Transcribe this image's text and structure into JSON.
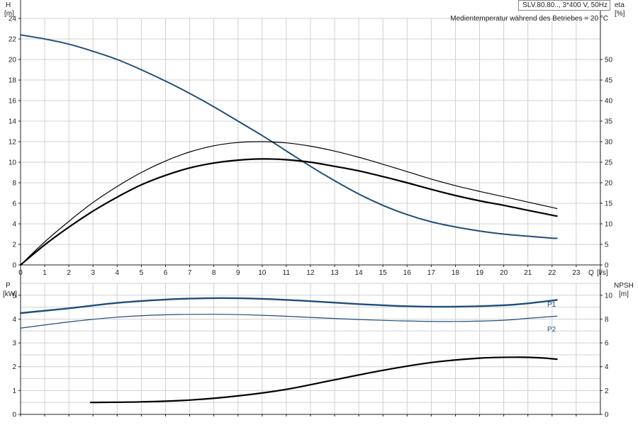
{
  "info": {
    "title": "SLV.80.80.., 3*400 V, 50Hz",
    "note": "Medientemperatur während des Betriebes = 20 °C"
  },
  "chart_data": [
    {
      "type": "line",
      "axes": {
        "x": {
          "label_name": "Q",
          "label_unit": "[l/s]",
          "range": [
            0,
            24
          ],
          "ticks": [
            0,
            1,
            2,
            3,
            4,
            5,
            6,
            7,
            8,
            9,
            10,
            11,
            12,
            13,
            14,
            15,
            16,
            17,
            18,
            19,
            20,
            21,
            22,
            23
          ]
        },
        "y_left": {
          "label_name": "H",
          "label_unit": "[m]",
          "range": [
            0,
            24
          ],
          "ticks": [
            0,
            2,
            4,
            6,
            8,
            10,
            12,
            14,
            16,
            18,
            20,
            22,
            24
          ]
        },
        "y_right": {
          "label_name": "eta",
          "label_unit": "[%]",
          "range": [
            0,
            60
          ],
          "ticks": [
            0,
            5,
            10,
            15,
            20,
            25,
            30,
            35,
            40,
            45,
            50
          ]
        }
      },
      "grid": true,
      "series": [
        {
          "axis": "left",
          "color": "#1f4e79",
          "width": 2,
          "points": [
            [
              0,
              22.4
            ],
            [
              1,
              22.0
            ],
            [
              2,
              21.5
            ],
            [
              3,
              20.8
            ],
            [
              4,
              20.0
            ],
            [
              5,
              19.0
            ],
            [
              6,
              17.9
            ],
            [
              7,
              16.7
            ],
            [
              8,
              15.4
            ],
            [
              9,
              14.0
            ],
            [
              10,
              12.6
            ],
            [
              11,
              11.1
            ],
            [
              12,
              9.6
            ],
            [
              13,
              8.2
            ],
            [
              14,
              6.9
            ],
            [
              15,
              5.8
            ],
            [
              16,
              4.9
            ],
            [
              17,
              4.2
            ],
            [
              18,
              3.7
            ],
            [
              19,
              3.3
            ],
            [
              20,
              3.0
            ],
            [
              21,
              2.8
            ],
            [
              22,
              2.6
            ],
            [
              22.2,
              2.6
            ]
          ]
        },
        {
          "axis": "right",
          "color": "#000000",
          "width": 1.2,
          "points": [
            [
              0,
              0
            ],
            [
              1,
              5.6
            ],
            [
              2,
              10.6
            ],
            [
              3,
              15.2
            ],
            [
              4,
              19.1
            ],
            [
              5,
              22.5
            ],
            [
              6,
              25.3
            ],
            [
              7,
              27.5
            ],
            [
              8,
              29.0
            ],
            [
              9,
              29.8
            ],
            [
              10,
              30.0
            ],
            [
              11,
              29.7
            ],
            [
              12,
              28.9
            ],
            [
              13,
              27.7
            ],
            [
              14,
              26.2
            ],
            [
              15,
              24.5
            ],
            [
              16,
              22.7
            ],
            [
              17,
              20.9
            ],
            [
              18,
              19.3
            ],
            [
              19,
              17.9
            ],
            [
              20,
              16.6
            ],
            [
              21,
              15.3
            ],
            [
              22,
              14.0
            ],
            [
              22.2,
              13.7
            ]
          ]
        },
        {
          "axis": "right",
          "color": "#000000",
          "width": 2.2,
          "points": [
            [
              0,
              0
            ],
            [
              1,
              4.9
            ],
            [
              2,
              9.2
            ],
            [
              3,
              13.1
            ],
            [
              4,
              16.5
            ],
            [
              5,
              19.5
            ],
            [
              6,
              21.8
            ],
            [
              7,
              23.6
            ],
            [
              8,
              24.8
            ],
            [
              9,
              25.5
            ],
            [
              10,
              25.8
            ],
            [
              11,
              25.6
            ],
            [
              12,
              25.0
            ],
            [
              13,
              24.0
            ],
            [
              14,
              22.9
            ],
            [
              15,
              21.5
            ],
            [
              16,
              20.0
            ],
            [
              17,
              18.4
            ],
            [
              18,
              16.9
            ],
            [
              19,
              15.6
            ],
            [
              20,
              14.5
            ],
            [
              21,
              13.3
            ],
            [
              22,
              12.1
            ],
            [
              22.2,
              11.9
            ]
          ]
        }
      ]
    },
    {
      "type": "line",
      "axes": {
        "x": {
          "range": [
            0,
            24
          ],
          "ticks": [
            0,
            1,
            2,
            3,
            4,
            5,
            6,
            7,
            8,
            9,
            10,
            11,
            12,
            13,
            14,
            15,
            16,
            17,
            18,
            19,
            20,
            21,
            22,
            23
          ]
        },
        "y_left": {
          "label_name": "P",
          "label_unit": "[kW]",
          "range": [
            0,
            5.5
          ],
          "ticks": [
            0,
            1,
            2,
            3,
            4,
            5
          ]
        },
        "y_right": {
          "label_name": "NPSH",
          "label_unit": "[m]",
          "range": [
            0,
            11
          ],
          "ticks": [
            0,
            2,
            4,
            6,
            8,
            10
          ]
        }
      },
      "grid": true,
      "series": [
        {
          "name": "P1",
          "axis": "left",
          "color": "#1f4e79",
          "width": 2.4,
          "points": [
            [
              0,
              4.25
            ],
            [
              2,
              4.45
            ],
            [
              4,
              4.68
            ],
            [
              6,
              4.82
            ],
            [
              8,
              4.88
            ],
            [
              10,
              4.85
            ],
            [
              12,
              4.75
            ],
            [
              14,
              4.63
            ],
            [
              16,
              4.54
            ],
            [
              18,
              4.52
            ],
            [
              20,
              4.58
            ],
            [
              21,
              4.66
            ],
            [
              22.2,
              4.8
            ]
          ]
        },
        {
          "name": "P2",
          "axis": "left",
          "color": "#1f4e79",
          "width": 1.2,
          "points": [
            [
              0,
              3.62
            ],
            [
              2,
              3.88
            ],
            [
              4,
              4.08
            ],
            [
              6,
              4.18
            ],
            [
              8,
              4.2
            ],
            [
              10,
              4.16
            ],
            [
              12,
              4.07
            ],
            [
              14,
              3.98
            ],
            [
              16,
              3.92
            ],
            [
              18,
              3.9
            ],
            [
              20,
              3.95
            ],
            [
              21,
              4.03
            ],
            [
              22.2,
              4.12
            ]
          ]
        },
        {
          "axis": "right",
          "color": "#000000",
          "width": 2.2,
          "points": [
            [
              2.9,
              1.0
            ],
            [
              5,
              1.05
            ],
            [
              7,
              1.2
            ],
            [
              9,
              1.55
            ],
            [
              11,
              2.1
            ],
            [
              13,
              2.9
            ],
            [
              15,
              3.7
            ],
            [
              17,
              4.35
            ],
            [
              19,
              4.72
            ],
            [
              20.5,
              4.8
            ],
            [
              21.5,
              4.75
            ],
            [
              22.2,
              4.63
            ]
          ]
        }
      ]
    }
  ]
}
